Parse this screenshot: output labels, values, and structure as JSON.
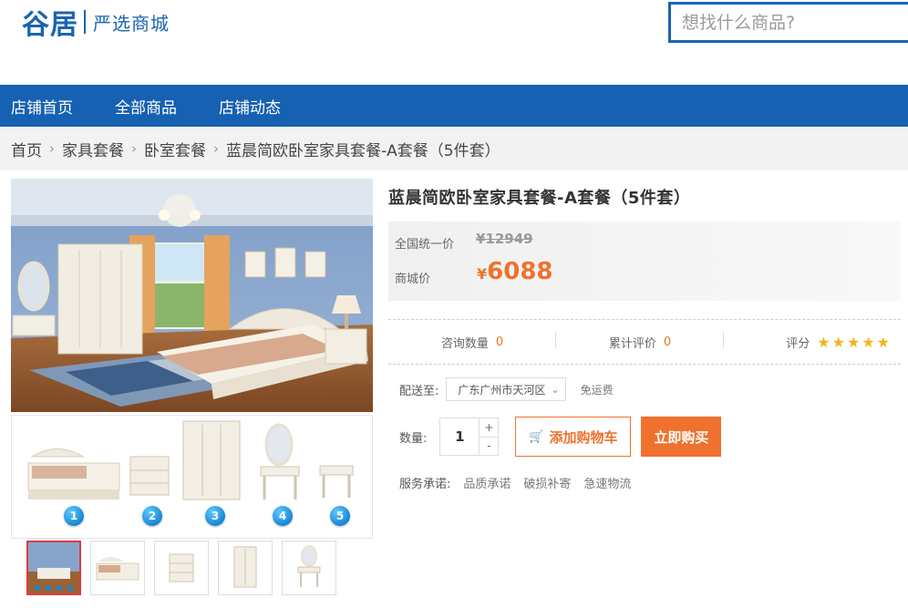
{
  "header": {
    "logo_text": "谷居",
    "logo_sub": "严选商城",
    "search_placeholder": "想找什么商品?"
  },
  "nav": {
    "items": [
      "店铺首页",
      "全部商品",
      "店铺动态"
    ]
  },
  "breadcrumb": {
    "items": [
      "首页",
      "家具套餐",
      "卧室套餐",
      "蓝晨简欧卧室家具套餐-A套餐（5件套）"
    ],
    "separator": "›"
  },
  "gallery": {
    "badges": [
      "1",
      "2",
      "3",
      "4",
      "5"
    ]
  },
  "product": {
    "title": "蓝晨简欧卧室家具套餐-A套餐（5件套）",
    "list_price_label": "全国统一价",
    "list_price": "¥12949",
    "price_label": "商城价",
    "price_symbol": "¥",
    "price_value": "6088",
    "consult_label": "咨询数量",
    "consult_count": "0",
    "review_label": "累计评价",
    "review_count": "0",
    "rating_label": "评分",
    "rating_stars": 5,
    "delivery_label": "配送至:",
    "delivery_region": "广东广州市天河区",
    "shipping_note": "免运费",
    "qty_label": "数量:",
    "qty_value": "1",
    "qty_plus": "+",
    "qty_minus": "-",
    "add_cart_label": "添加购物车",
    "buy_now_label": "立即购买",
    "service_label": "服务承诺:",
    "services": [
      "品质承诺",
      "破损补寄",
      "急速物流"
    ]
  },
  "colors": {
    "brand_blue": "#1661b1",
    "accent_orange": "#f0712d",
    "star_gold": "#f3b51b"
  }
}
